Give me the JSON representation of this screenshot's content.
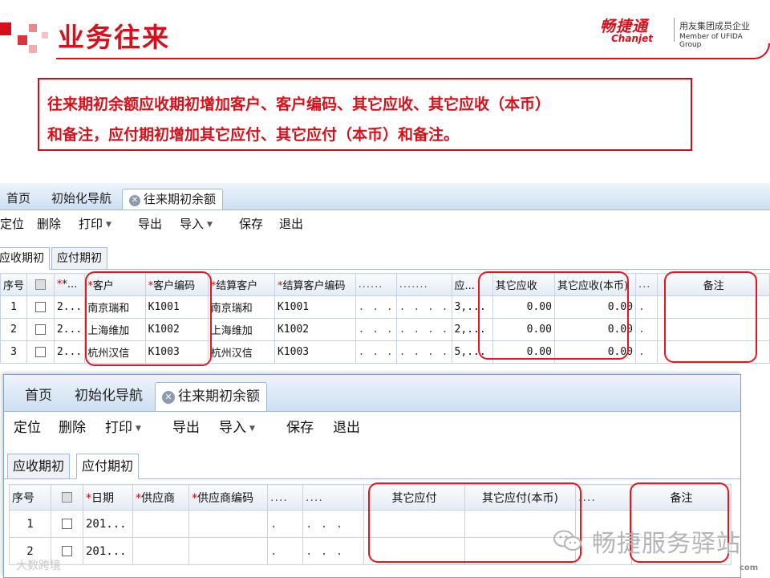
{
  "slide": {
    "title": "业务往来",
    "logo_cn": "畅捷通",
    "logo_en": "Chanjet",
    "logo_tag1": "用友集团成员企业",
    "logo_tag2": "Member of UFIDA Group",
    "callout_line1": "往来期初余额应收期初增加客户、客户编码、其它应收、其它应收（本币）",
    "callout_line2": "和备注，应付期初增加其它应付、其它应付（本币）和备注。",
    "accent_color": "#d6111b"
  },
  "window1": {
    "tabs": [
      "首页",
      "初始化导航",
      "往来期初余额"
    ],
    "toolbar": {
      "locate": "定位",
      "delete": "删除",
      "print": "打印",
      "export": "导出",
      "import": "导入",
      "save": "保存",
      "exit": "退出"
    },
    "subtabs": [
      "应收期初",
      "应付期初"
    ],
    "columns": {
      "seq": "序号",
      "date": "*...",
      "customer": "客户",
      "customer_code": "客户编码",
      "settle_customer": "结算客户",
      "settle_code": "结算客户编码",
      "dots1": "......",
      "dots2": ".......",
      "amount": "应...",
      "other_recv": "其它应收",
      "other_recv_local": "其它应收(本币)",
      "dots3": "...",
      "remark": "备注"
    },
    "rows": [
      {
        "seq": "1",
        "date": "2...",
        "customer": "南京瑞和",
        "code": "K1001",
        "settle": "南京瑞和",
        "settle_code": "K1001",
        "d1": ". . .",
        "d2": ". . . .",
        "amt": "3,...",
        "other": "0.00",
        "other_local": "0.00",
        "d3": "."
      },
      {
        "seq": "2",
        "date": "2...",
        "customer": "上海维加",
        "code": "K1002",
        "settle": "上海维加",
        "settle_code": "K1002",
        "d1": ". . .",
        "d2": ". . . .",
        "amt": "2,...",
        "other": "0.00",
        "other_local": "0.00",
        "d3": "."
      },
      {
        "seq": "3",
        "date": "2...",
        "customer": "杭州汉信",
        "code": "K1003",
        "settle": "杭州汉信",
        "settle_code": "K1003",
        "d1": ". . .",
        "d2": ". . . .",
        "amt": "5,...",
        "other": "0.00",
        "other_local": "0.00",
        "d3": "."
      }
    ]
  },
  "window2": {
    "tabs": [
      "首页",
      "初始化导航",
      "往来期初余额"
    ],
    "toolbar": {
      "locate": "定位",
      "delete": "删除",
      "print": "打印",
      "export": "导出",
      "import": "导入",
      "save": "保存",
      "exit": "退出"
    },
    "subtabs": [
      "应收期初",
      "应付期初"
    ],
    "columns": {
      "seq": "序号",
      "date": "日期",
      "supplier": "供应商",
      "supplier_code": "供应商编码",
      "dots1": "....",
      "dots2": "....",
      "other_pay": "其它应付",
      "other_pay_local": "其它应付(本币)",
      "dots3": "....",
      "remark": "备注"
    },
    "rows": [
      {
        "seq": "1",
        "date": "201..."
      },
      {
        "seq": "2",
        "date": "201..."
      }
    ]
  },
  "watermark": {
    "right": "畅捷服务驿站",
    "left": "大数跨境",
    "com": "com"
  }
}
